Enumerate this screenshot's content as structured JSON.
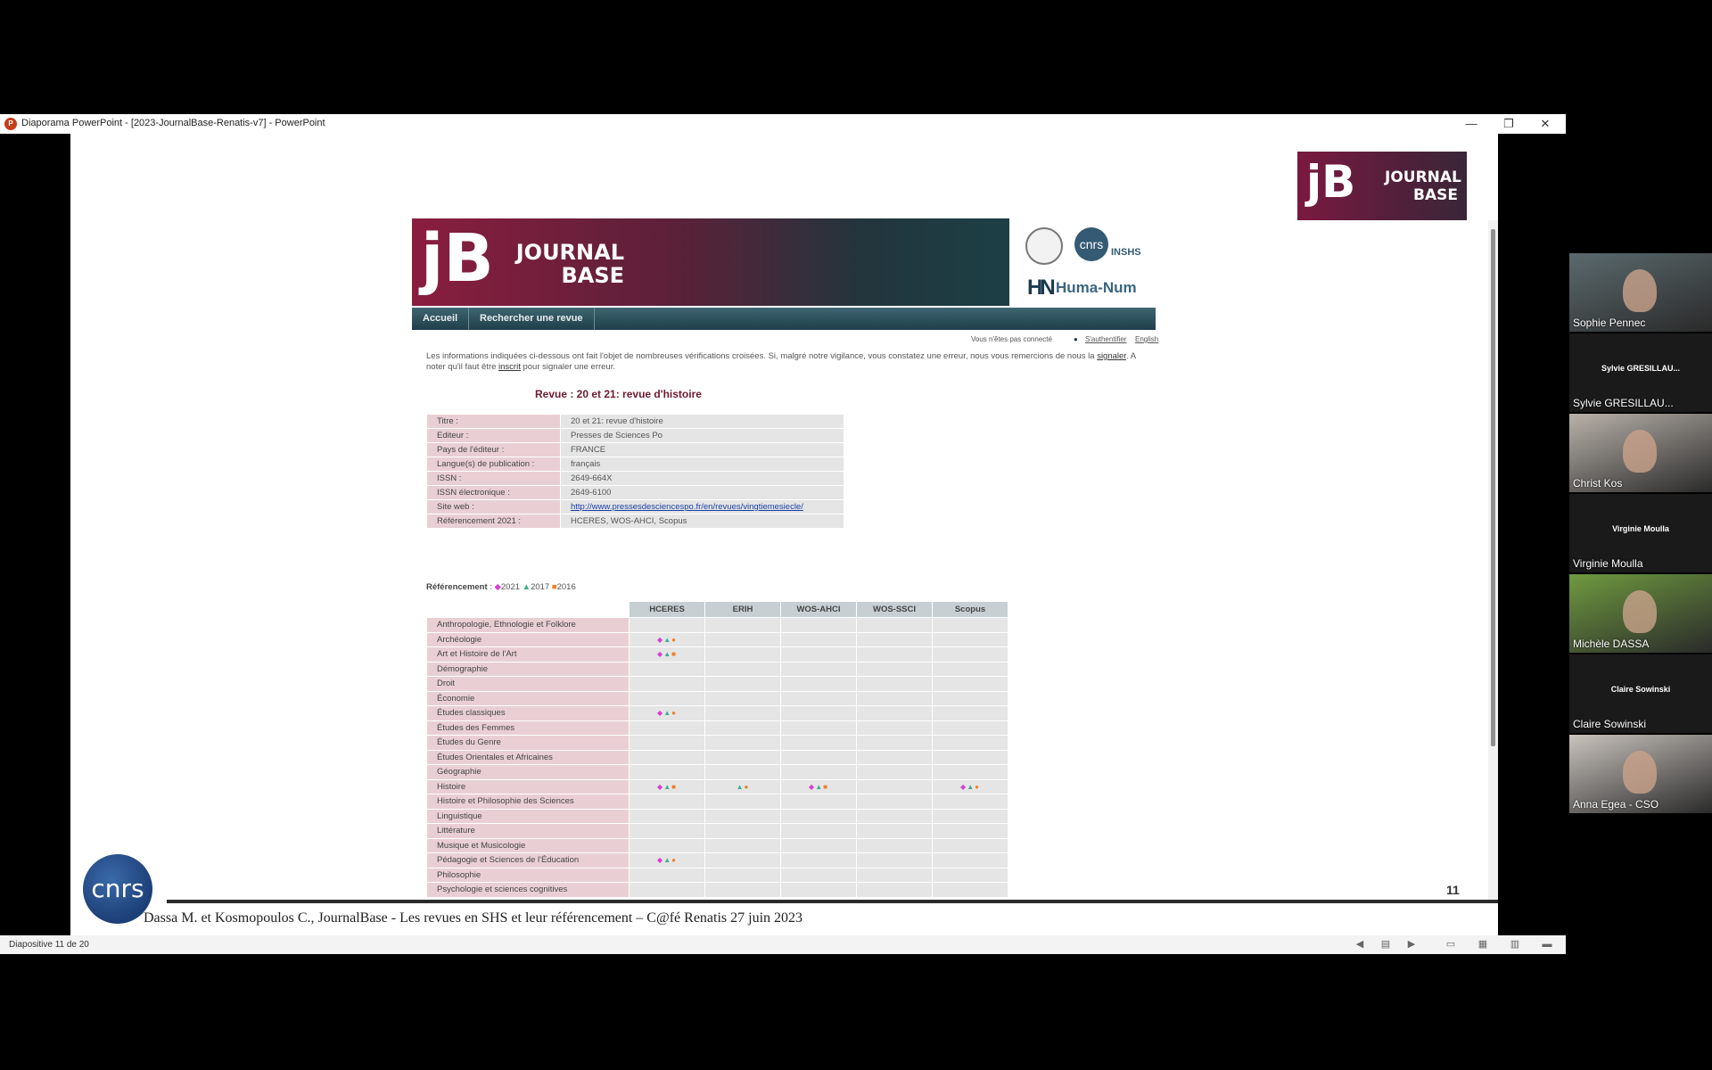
{
  "window": {
    "title": "Diaporama PowerPoint - [2023-JournalBase-Renatis-v7] - PowerPoint",
    "minimize": "—",
    "restore": "❐",
    "close": "✕"
  },
  "statusbar": {
    "slide_label": "Diapositive 11 de 20"
  },
  "logo": {
    "mark": "jB",
    "word1": "JOURNAL",
    "word2": "BASE"
  },
  "site": {
    "partners": {
      "cnrs": "cnrs",
      "insh": "INSHS",
      "humanum": "Huma-Num",
      "hn": "HN"
    },
    "nav": [
      "Accueil",
      "Rechercher une revue"
    ],
    "connect": {
      "status": "Vous n'êtes pas connecté",
      "auth": "S'authentifier",
      "lang": "English"
    },
    "notice": {
      "part1": "Les informations indiquées ci-dessous ont fait l'objet de nombreuses vérifications croisées. Si, malgré notre vigilance, vous constatez une erreur, nous vous remercions de nous la",
      "link1": "signaler",
      "part2": ". A noter qu'il faut être",
      "link2": "inscrit",
      "part3": "pour signaler une erreur."
    },
    "revue_title": "Revue : 20 et 21: revue d'histoire",
    "info": [
      {
        "k": "Titre :",
        "v": "20 et 21: revue d'histoire"
      },
      {
        "k": "Editeur :",
        "v": "Presses de Sciences Po"
      },
      {
        "k": "Pays de l'éditeur :",
        "v": "FRANCE"
      },
      {
        "k": "Langue(s) de publication :",
        "v": "français"
      },
      {
        "k": "ISSN :",
        "v": "2649-664X"
      },
      {
        "k": "ISSN électronique :",
        "v": "2649-6100"
      },
      {
        "k": "Site web :",
        "v": "http://www.pressesdesciencespo.fr/en/revues/vingtiemesiecle/"
      },
      {
        "k": "Référencement 2021 :",
        "v": "HCERES, WOS-AHCI, Scopus"
      }
    ],
    "legend": {
      "label": "Référencement",
      "y2021": "2021",
      "y2017": "2017",
      "y2016": "2016"
    },
    "grid_headers": [
      "HCERES",
      "ERIH",
      "WOS-AHCI",
      "WOS-SSCI",
      "Scopus"
    ],
    "grid_rows": [
      {
        "d": "Anthropologie, Ethnologie et Folklore",
        "c": [
          "",
          "",
          "",
          "",
          ""
        ]
      },
      {
        "d": "Archéologie",
        "c": [
          "◆▲●",
          "",
          "",
          "",
          ""
        ]
      },
      {
        "d": "Art et Histoire de l'Art",
        "c": [
          "◆▲■",
          "",
          "",
          "",
          ""
        ]
      },
      {
        "d": "Démographie",
        "c": [
          "",
          "",
          "",
          "",
          ""
        ]
      },
      {
        "d": "Droit",
        "c": [
          "",
          "",
          "",
          "",
          ""
        ]
      },
      {
        "d": "Économie",
        "c": [
          "",
          "",
          "",
          "",
          ""
        ]
      },
      {
        "d": "Études classiques",
        "c": [
          "◆▲●",
          "",
          "",
          "",
          ""
        ]
      },
      {
        "d": "Études des Femmes",
        "c": [
          "",
          "",
          "",
          "",
          ""
        ]
      },
      {
        "d": "Études du Genre",
        "c": [
          "",
          "",
          "",
          "",
          ""
        ]
      },
      {
        "d": "Études Orientales et Africaines",
        "c": [
          "",
          "",
          "",
          "",
          ""
        ]
      },
      {
        "d": "Géographie",
        "c": [
          "",
          "",
          "",
          "",
          ""
        ]
      },
      {
        "d": "Histoire",
        "c": [
          "◆▲■",
          "▲●",
          "◆▲■",
          "",
          "◆▲●"
        ]
      },
      {
        "d": "Histoire et Philosophie des Sciences",
        "c": [
          "",
          "",
          "",
          "",
          ""
        ]
      },
      {
        "d": "Linguistique",
        "c": [
          "",
          "",
          "",
          "",
          ""
        ]
      },
      {
        "d": "Littérature",
        "c": [
          "",
          "",
          "",
          "",
          ""
        ]
      },
      {
        "d": "Musique et Musicologie",
        "c": [
          "",
          "",
          "",
          "",
          ""
        ]
      },
      {
        "d": "Pédagogie et Sciences de l'Éducation",
        "c": [
          "◆▲●",
          "",
          "",
          "",
          ""
        ]
      },
      {
        "d": "Philosophie",
        "c": [
          "",
          "",
          "",
          "",
          ""
        ]
      },
      {
        "d": "Psychologie et sciences cognitives",
        "c": [
          "",
          "",
          "",
          "",
          ""
        ]
      }
    ]
  },
  "slide": {
    "page_number": "11",
    "footer": "Dassa M. et Kosmopoulos C., JournalBase - Les revues en SHS et leur référencement – C@fé Renatis 27 juin 2023",
    "cnrs_logo": "cnrs"
  },
  "participants": [
    {
      "name": "Sophie Pennec",
      "video": true,
      "color": "#5b6a6e"
    },
    {
      "name": "Sylvie GRESILLAU...",
      "video": false,
      "center": "Sylvie GRESILLAU..."
    },
    {
      "name": "Christ Kos",
      "video": true,
      "color": "#b9b2aa"
    },
    {
      "name": "Virginie Moulla",
      "video": false,
      "center": "Virginie Moulla"
    },
    {
      "name": "Michèle DASSA",
      "video": true,
      "color": "#6f9a3f"
    },
    {
      "name": "Claire Sowinski",
      "video": false,
      "center": "Claire Sowinski"
    },
    {
      "name": "Anna Egea - CSO",
      "video": true,
      "color": "#c9c3bd"
    }
  ]
}
